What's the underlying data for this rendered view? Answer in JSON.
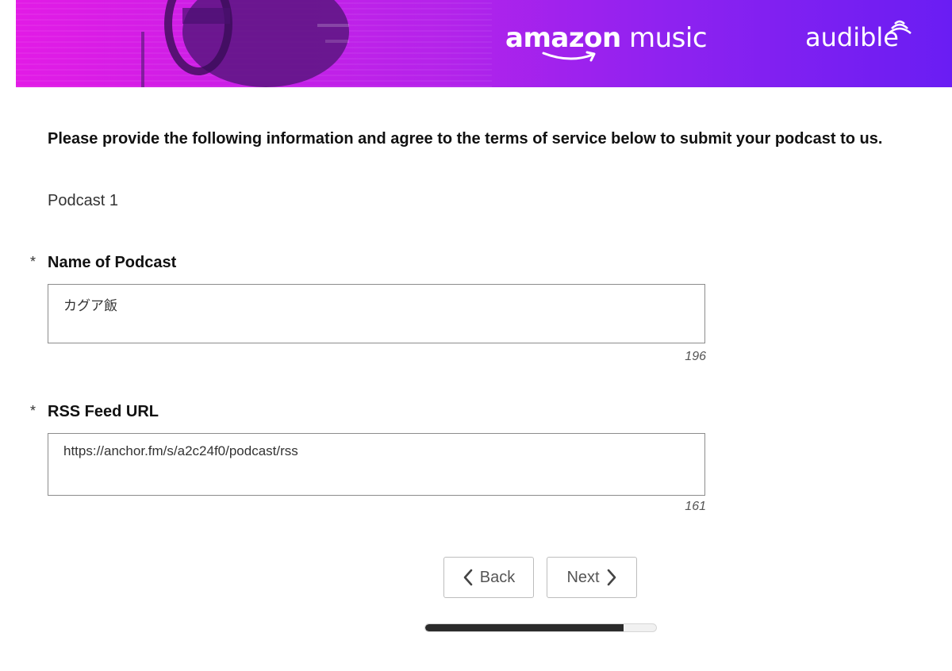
{
  "header": {
    "brand_amazon_part1": "amazon",
    "brand_amazon_part2": "music",
    "brand_audible": "audible",
    "colors": {
      "gradient_start": "#e21be6",
      "gradient_end": "#6a1df3"
    }
  },
  "intro_text": "Please provide the following information and agree to the terms of service below to submit your podcast to us.",
  "section_title": "Podcast 1",
  "fields": {
    "podcast_name": {
      "required_marker": "*",
      "label": "Name of Podcast",
      "value": "カグア飯",
      "remaining_chars": "196"
    },
    "rss_feed_url": {
      "required_marker": "*",
      "label": "RSS Feed URL",
      "value": "https://anchor.fm/s/a2c24f0/podcast/rss",
      "remaining_chars": "161"
    }
  },
  "navigation": {
    "back_label": "Back",
    "next_label": "Next"
  },
  "progress": {
    "fraction": 0.86
  }
}
